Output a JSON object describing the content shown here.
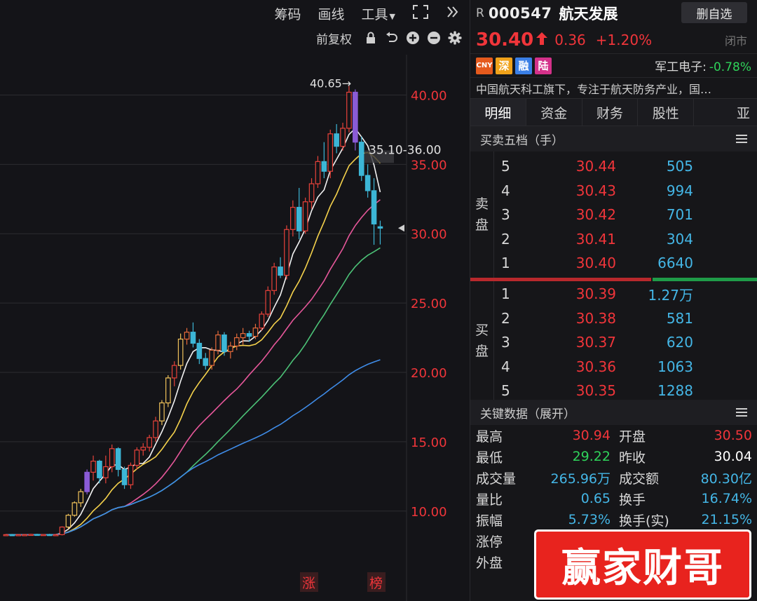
{
  "toolbar": {
    "chip_label": "筹码",
    "draw_label": "画线",
    "tools_label": "工具",
    "adjust_label": "前复权"
  },
  "chart_data": {
    "type": "candlestick",
    "ylim": [
      6.5,
      42.5
    ],
    "y_ticks": [
      "40.00",
      "35.00",
      "30.00",
      "25.00",
      "20.00",
      "15.00",
      "10.00"
    ],
    "y_tick_values": [
      40,
      35,
      30,
      25,
      20,
      15,
      10
    ],
    "high_label": "40.65",
    "zone_label": "35.10-36.00",
    "zone_range": [
      35.1,
      36.0
    ],
    "current_price": 30.4,
    "bottom_labels": [
      "涨",
      "榜"
    ],
    "candles": [
      [
        8.3,
        8.35,
        8.2,
        8.3
      ],
      [
        8.3,
        8.35,
        8.2,
        8.28
      ],
      [
        8.28,
        8.32,
        8.2,
        8.3
      ],
      [
        8.3,
        8.34,
        8.22,
        8.3
      ],
      [
        8.3,
        8.36,
        8.22,
        8.32
      ],
      [
        8.32,
        8.36,
        8.25,
        8.3
      ],
      [
        8.3,
        8.34,
        8.24,
        8.31
      ],
      [
        8.31,
        8.36,
        8.25,
        8.3
      ],
      [
        8.3,
        8.35,
        8.24,
        8.3
      ],
      [
        8.3,
        8.9,
        8.25,
        8.85
      ],
      [
        8.85,
        9.8,
        8.7,
        9.7
      ],
      [
        9.7,
        10.7,
        9.6,
        10.6
      ],
      [
        10.6,
        11.6,
        10.3,
        11.4
      ],
      [
        11.4,
        13.0,
        11.2,
        12.8
      ],
      [
        12.8,
        14.0,
        12.2,
        13.6
      ],
      [
        13.6,
        13.7,
        12.0,
        12.4
      ],
      [
        12.4,
        14.0,
        12.0,
        13.2
      ],
      [
        13.2,
        14.8,
        12.8,
        14.5
      ],
      [
        14.5,
        14.6,
        12.5,
        13.0
      ],
      [
        13.0,
        13.2,
        11.6,
        11.9
      ],
      [
        11.9,
        13.5,
        11.6,
        13.3
      ],
      [
        13.3,
        14.6,
        13.0,
        14.4
      ],
      [
        14.4,
        14.9,
        14.0,
        14.6
      ],
      [
        14.6,
        15.5,
        14.3,
        15.3
      ],
      [
        15.3,
        16.8,
        15.0,
        16.5
      ],
      [
        16.5,
        18.0,
        16.2,
        17.8
      ],
      [
        17.8,
        19.8,
        17.5,
        19.6
      ],
      [
        19.6,
        20.8,
        19.0,
        20.5
      ],
      [
        20.5,
        22.8,
        20.2,
        22.4
      ],
      [
        22.4,
        23.2,
        22.0,
        22.9
      ],
      [
        22.9,
        23.6,
        21.8,
        22.1
      ],
      [
        22.1,
        22.4,
        20.6,
        21.0
      ],
      [
        21.0,
        21.4,
        20.2,
        20.5
      ],
      [
        20.5,
        21.8,
        20.2,
        21.6
      ],
      [
        21.6,
        23.0,
        21.3,
        22.7
      ],
      [
        22.7,
        22.9,
        21.2,
        21.5
      ],
      [
        21.5,
        22.2,
        21.0,
        21.9
      ],
      [
        21.9,
        22.8,
        21.6,
        22.5
      ],
      [
        22.5,
        23.2,
        22.0,
        22.8
      ],
      [
        22.8,
        23.0,
        22.2,
        22.6
      ],
      [
        22.6,
        23.5,
        22.4,
        23.2
      ],
      [
        23.2,
        24.4,
        23.0,
        24.2
      ],
      [
        24.2,
        26.2,
        24.0,
        25.9
      ],
      [
        25.9,
        27.9,
        25.6,
        27.6
      ],
      [
        27.6,
        28.3,
        26.8,
        27.0
      ],
      [
        27.0,
        30.6,
        26.7,
        30.3
      ],
      [
        30.3,
        32.4,
        29.8,
        31.9
      ],
      [
        31.9,
        33.3,
        29.6,
        30.2
      ],
      [
        30.2,
        32.6,
        30.0,
        32.3
      ],
      [
        32.3,
        34.0,
        31.8,
        33.6
      ],
      [
        33.6,
        35.6,
        33.3,
        35.2
      ],
      [
        35.2,
        36.6,
        34.0,
        34.5
      ],
      [
        34.5,
        37.5,
        34.0,
        37.2
      ],
      [
        37.2,
        37.9,
        35.8,
        36.3
      ],
      [
        36.3,
        38.0,
        36.0,
        37.6
      ],
      [
        37.6,
        40.65,
        37.3,
        40.2
      ],
      [
        40.2,
        40.4,
        36.0,
        36.6
      ],
      [
        36.6,
        37.0,
        33.8,
        34.2
      ],
      [
        34.2,
        35.0,
        32.6,
        33.1
      ],
      [
        33.1,
        34.0,
        29.2,
        30.7
      ],
      [
        30.5,
        30.94,
        29.22,
        30.4
      ]
    ],
    "ma_colors": [
      "#f2f2f2",
      "#f5d24c",
      "#e6579a",
      "#4cc277",
      "#3f8ce8"
    ]
  },
  "quote": {
    "prefix": "R",
    "code": "000547",
    "name": "航天发展",
    "watch_button": "删自选",
    "price": "30.40",
    "change": "0.36",
    "change_pct": "+1.20%",
    "status": "闭市",
    "tags": [
      "CNY",
      "深",
      "融",
      "陆"
    ],
    "sector_name": "军工电子:",
    "sector_pct": "-0.78%",
    "description": "中国航天科工旗下，专注于航天防务产业，国…",
    "tabs": [
      "明细",
      "资金",
      "财务",
      "股性",
      "亚"
    ],
    "order_book_title": "买卖五档（手）",
    "sell_label": [
      "卖",
      "盘"
    ],
    "buy_label": [
      "买",
      "盘"
    ],
    "asks": [
      {
        "level": "5",
        "price": "30.44",
        "volume": "505"
      },
      {
        "level": "4",
        "price": "30.43",
        "volume": "994"
      },
      {
        "level": "3",
        "price": "30.42",
        "volume": "701"
      },
      {
        "level": "2",
        "price": "30.41",
        "volume": "304"
      },
      {
        "level": "1",
        "price": "30.40",
        "volume": "6640"
      }
    ],
    "bids": [
      {
        "level": "1",
        "price": "30.39",
        "volume": "1.27万"
      },
      {
        "level": "2",
        "price": "30.38",
        "volume": "581"
      },
      {
        "level": "3",
        "price": "30.37",
        "volume": "620"
      },
      {
        "level": "4",
        "price": "30.36",
        "volume": "1063"
      },
      {
        "level": "5",
        "price": "30.35",
        "volume": "1288"
      }
    ],
    "buy_ratio": 0.63,
    "key_data_title": "关键数据（展开）",
    "key_data": [
      {
        "l1": "最高",
        "v1": "30.94",
        "c1": "red",
        "l2": "开盘",
        "v2": "30.50",
        "c2": "red"
      },
      {
        "l1": "最低",
        "v1": "29.22",
        "c1": "green",
        "l2": "昨收",
        "v2": "30.04",
        "c2": "white"
      },
      {
        "l1": "成交量",
        "v1": "265.96万",
        "c1": "cyan",
        "l2": "成交额",
        "v2": "80.30亿",
        "c2": "cyan"
      },
      {
        "l1": "量比",
        "v1": "0.65",
        "c1": "cyan",
        "l2": "换手",
        "v2": "16.74%",
        "c2": "cyan"
      },
      {
        "l1": "振幅",
        "v1": "5.73%",
        "c1": "cyan",
        "l2": "换手(实)",
        "v2": "21.15%",
        "c2": "cyan"
      },
      {
        "l1": "涨停",
        "v1": "",
        "c1": "red",
        "l2": "",
        "v2": "",
        "c2": "red"
      },
      {
        "l1": "外盘",
        "v1": "",
        "c1": "red",
        "l2": "",
        "v2": "",
        "c2": "red"
      }
    ]
  },
  "watermark": "赢家财哥"
}
